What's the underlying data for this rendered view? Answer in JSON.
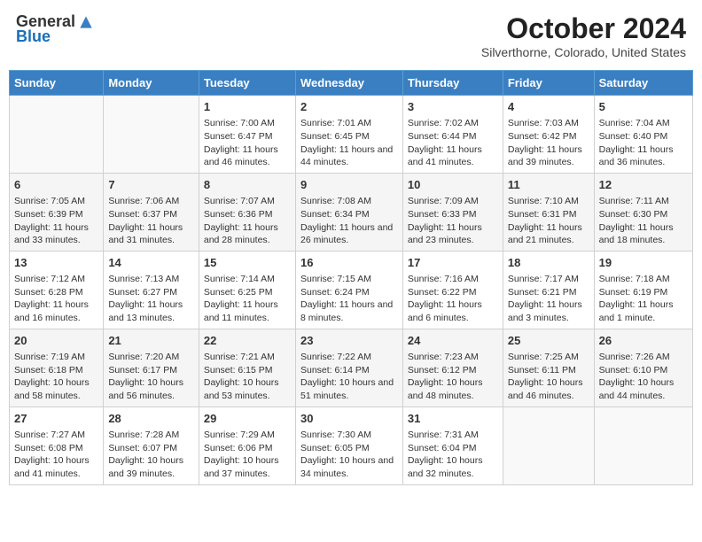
{
  "header": {
    "logo_line1": "General",
    "logo_line2": "Blue",
    "month_title": "October 2024",
    "location": "Silverthorne, Colorado, United States"
  },
  "days_of_week": [
    "Sunday",
    "Monday",
    "Tuesday",
    "Wednesday",
    "Thursday",
    "Friday",
    "Saturday"
  ],
  "weeks": [
    [
      {
        "day": "",
        "info": ""
      },
      {
        "day": "",
        "info": ""
      },
      {
        "day": "1",
        "info": "Sunrise: 7:00 AM\nSunset: 6:47 PM\nDaylight: 11 hours and 46 minutes."
      },
      {
        "day": "2",
        "info": "Sunrise: 7:01 AM\nSunset: 6:45 PM\nDaylight: 11 hours and 44 minutes."
      },
      {
        "day": "3",
        "info": "Sunrise: 7:02 AM\nSunset: 6:44 PM\nDaylight: 11 hours and 41 minutes."
      },
      {
        "day": "4",
        "info": "Sunrise: 7:03 AM\nSunset: 6:42 PM\nDaylight: 11 hours and 39 minutes."
      },
      {
        "day": "5",
        "info": "Sunrise: 7:04 AM\nSunset: 6:40 PM\nDaylight: 11 hours and 36 minutes."
      }
    ],
    [
      {
        "day": "6",
        "info": "Sunrise: 7:05 AM\nSunset: 6:39 PM\nDaylight: 11 hours and 33 minutes."
      },
      {
        "day": "7",
        "info": "Sunrise: 7:06 AM\nSunset: 6:37 PM\nDaylight: 11 hours and 31 minutes."
      },
      {
        "day": "8",
        "info": "Sunrise: 7:07 AM\nSunset: 6:36 PM\nDaylight: 11 hours and 28 minutes."
      },
      {
        "day": "9",
        "info": "Sunrise: 7:08 AM\nSunset: 6:34 PM\nDaylight: 11 hours and 26 minutes."
      },
      {
        "day": "10",
        "info": "Sunrise: 7:09 AM\nSunset: 6:33 PM\nDaylight: 11 hours and 23 minutes."
      },
      {
        "day": "11",
        "info": "Sunrise: 7:10 AM\nSunset: 6:31 PM\nDaylight: 11 hours and 21 minutes."
      },
      {
        "day": "12",
        "info": "Sunrise: 7:11 AM\nSunset: 6:30 PM\nDaylight: 11 hours and 18 minutes."
      }
    ],
    [
      {
        "day": "13",
        "info": "Sunrise: 7:12 AM\nSunset: 6:28 PM\nDaylight: 11 hours and 16 minutes."
      },
      {
        "day": "14",
        "info": "Sunrise: 7:13 AM\nSunset: 6:27 PM\nDaylight: 11 hours and 13 minutes."
      },
      {
        "day": "15",
        "info": "Sunrise: 7:14 AM\nSunset: 6:25 PM\nDaylight: 11 hours and 11 minutes."
      },
      {
        "day": "16",
        "info": "Sunrise: 7:15 AM\nSunset: 6:24 PM\nDaylight: 11 hours and 8 minutes."
      },
      {
        "day": "17",
        "info": "Sunrise: 7:16 AM\nSunset: 6:22 PM\nDaylight: 11 hours and 6 minutes."
      },
      {
        "day": "18",
        "info": "Sunrise: 7:17 AM\nSunset: 6:21 PM\nDaylight: 11 hours and 3 minutes."
      },
      {
        "day": "19",
        "info": "Sunrise: 7:18 AM\nSunset: 6:19 PM\nDaylight: 11 hours and 1 minute."
      }
    ],
    [
      {
        "day": "20",
        "info": "Sunrise: 7:19 AM\nSunset: 6:18 PM\nDaylight: 10 hours and 58 minutes."
      },
      {
        "day": "21",
        "info": "Sunrise: 7:20 AM\nSunset: 6:17 PM\nDaylight: 10 hours and 56 minutes."
      },
      {
        "day": "22",
        "info": "Sunrise: 7:21 AM\nSunset: 6:15 PM\nDaylight: 10 hours and 53 minutes."
      },
      {
        "day": "23",
        "info": "Sunrise: 7:22 AM\nSunset: 6:14 PM\nDaylight: 10 hours and 51 minutes."
      },
      {
        "day": "24",
        "info": "Sunrise: 7:23 AM\nSunset: 6:12 PM\nDaylight: 10 hours and 48 minutes."
      },
      {
        "day": "25",
        "info": "Sunrise: 7:25 AM\nSunset: 6:11 PM\nDaylight: 10 hours and 46 minutes."
      },
      {
        "day": "26",
        "info": "Sunrise: 7:26 AM\nSunset: 6:10 PM\nDaylight: 10 hours and 44 minutes."
      }
    ],
    [
      {
        "day": "27",
        "info": "Sunrise: 7:27 AM\nSunset: 6:08 PM\nDaylight: 10 hours and 41 minutes."
      },
      {
        "day": "28",
        "info": "Sunrise: 7:28 AM\nSunset: 6:07 PM\nDaylight: 10 hours and 39 minutes."
      },
      {
        "day": "29",
        "info": "Sunrise: 7:29 AM\nSunset: 6:06 PM\nDaylight: 10 hours and 37 minutes."
      },
      {
        "day": "30",
        "info": "Sunrise: 7:30 AM\nSunset: 6:05 PM\nDaylight: 10 hours and 34 minutes."
      },
      {
        "day": "31",
        "info": "Sunrise: 7:31 AM\nSunset: 6:04 PM\nDaylight: 10 hours and 32 minutes."
      },
      {
        "day": "",
        "info": ""
      },
      {
        "day": "",
        "info": ""
      }
    ]
  ]
}
